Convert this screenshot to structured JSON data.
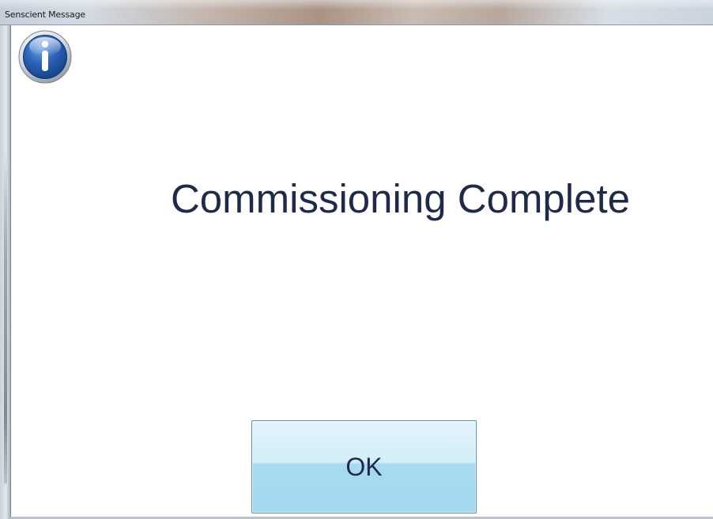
{
  "window": {
    "title": "Senscient Message"
  },
  "dialog": {
    "icon": "info-icon",
    "message": "Commissioning Complete",
    "ok_label": "OK"
  },
  "colors": {
    "message_text": "#1d2a4a",
    "button_top": "#e6f4fb",
    "button_bottom": "#a3d8f0",
    "icon_blue": "#2a63b8"
  }
}
